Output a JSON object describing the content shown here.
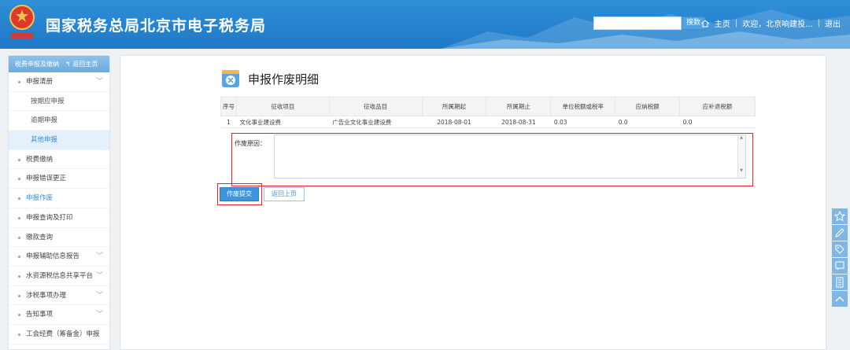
{
  "header": {
    "title": "国家税务总局北京市电子税务局",
    "search_placeholder": "",
    "search_button": "搜数",
    "home_link": "主页",
    "welcome_text": "欢迎，北京响建投...",
    "logout_link": "退出"
  },
  "sidebar": {
    "head_label": "税费申报及缴纳",
    "back_label": "返回主页",
    "items": [
      {
        "label": "申报清册",
        "expandable": true
      },
      {
        "label": "按期应申报",
        "sub": true
      },
      {
        "label": "逾期申报",
        "sub": true
      },
      {
        "label": "其他申报",
        "sub": true,
        "active": true
      },
      {
        "label": "税费缴纳"
      },
      {
        "label": "申报错误更正"
      },
      {
        "label": "申报作废",
        "highlight": true
      },
      {
        "label": "申报查询及打印"
      },
      {
        "label": "缴款查询"
      },
      {
        "label": "申报辅助信息报告",
        "expandable": true
      },
      {
        "label": "水资源税信息共享平台",
        "expandable": true
      },
      {
        "label": "涉税事项办理",
        "expandable": true
      },
      {
        "label": "告知事项",
        "expandable": true
      },
      {
        "label": "工会经费（筹备金）申报"
      }
    ]
  },
  "main": {
    "page_title": "申报作废明细",
    "table": {
      "headers": [
        "序号",
        "征收项目",
        "征收品目",
        "所属期起",
        "所属期止",
        "单位税额或税率",
        "应纳税额",
        "应补退税额"
      ],
      "rows": [
        [
          "1",
          "文化事业建设费",
          "广告业文化事业建设费",
          "2018-08-01",
          "2018-08-31",
          "0.03",
          "0.0",
          "0.0"
        ]
      ]
    },
    "reason_label": "作废原因：",
    "reason_value": "",
    "submit_button": "作废提交",
    "back_button": "返回上页"
  },
  "colors": {
    "header_blue": "#1f78c8",
    "accent_blue": "#3f95db",
    "highlight_red": "#e0242f"
  }
}
